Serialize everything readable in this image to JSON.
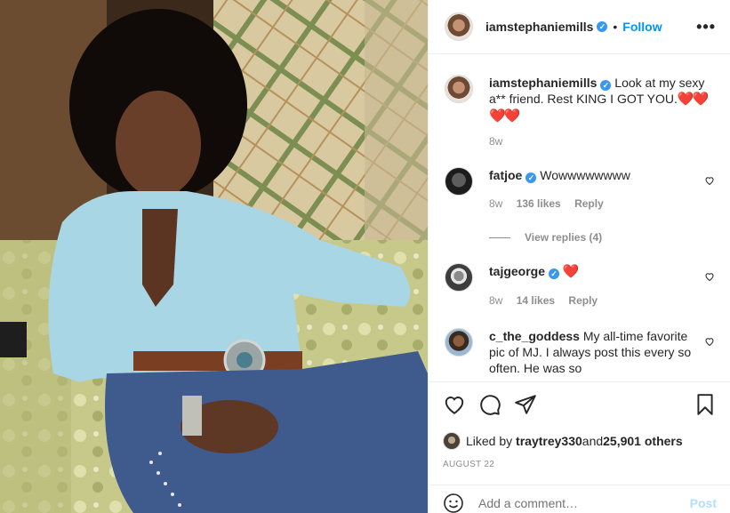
{
  "photo": {
    "alt_icon": "post-photo"
  },
  "header": {
    "username": "iamstephaniemills",
    "verified": "✓",
    "separator": "•",
    "follow_label": "Follow",
    "more_label": "•••"
  },
  "caption": {
    "username": "iamstephaniemills",
    "text_part1": "Look at my sexy a",
    "text_censored": "**",
    "text_part2": " friend. Rest KING I GOT YOU.",
    "hearts_inline": "❤️❤️",
    "hearts_line2": "❤️❤️",
    "time": "8w"
  },
  "comments": [
    {
      "username": "fatjoe",
      "text": "Wowwwwwwww",
      "time": "8w",
      "likes": "136 likes",
      "reply": "Reply"
    },
    {
      "username": "tajgeorge",
      "text": "❤️",
      "time": "8w",
      "likes": "14 likes",
      "reply": "Reply"
    },
    {
      "username": "c_the_goddess",
      "text": "My all-time favorite pic of MJ. I always post this every so often. He was so"
    }
  ],
  "view_replies": "View replies (4)",
  "likes": {
    "prefix": "Liked by ",
    "user": "traytrey330",
    "middle": " and ",
    "count": "25,901 others"
  },
  "date": "AUGUST 22",
  "add_comment": {
    "placeholder": "Add a comment…",
    "post_label": "Post"
  }
}
